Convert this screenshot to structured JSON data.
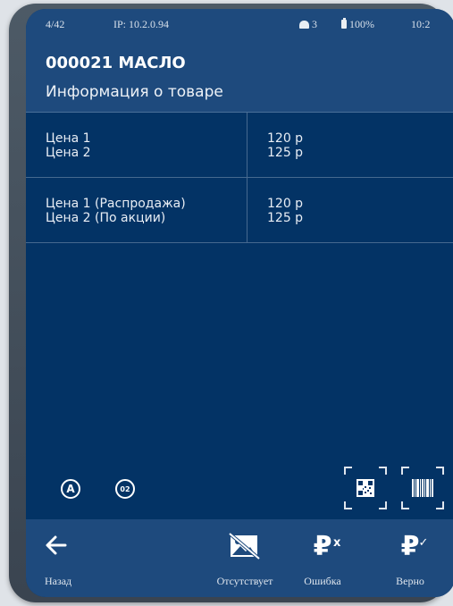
{
  "status": {
    "counter": "4/42",
    "ip": "IP: 10.2.0.94",
    "users": "3",
    "battery": "100%",
    "time": "10:2"
  },
  "header": {
    "title": "000021 МАСЛО",
    "subtitle": "Информация о товаре"
  },
  "prices": [
    {
      "label1": "Цена 1",
      "label2": "Цена 2",
      "value1": "120 р",
      "value2": "125 р"
    },
    {
      "label1": "Цена 1 (Распродажа)",
      "label2": "Цена 2 (По акции)",
      "value1": "120 р",
      "value2": "125 р"
    }
  ],
  "badges": {
    "a": "A",
    "b": "02"
  },
  "icons": {
    "users": "person-icon",
    "battery": "battery-icon",
    "back": "arrow-left-icon",
    "missing": "image-missing-icon",
    "error": "ruble-x-icon",
    "correct": "ruble-check-icon",
    "qr": "qr-code-scan-icon",
    "barcode": "barcode-scan-icon"
  },
  "actions": {
    "back": "Назад",
    "missing": "Отсутствует",
    "error": "Ошибка",
    "correct": "Верно",
    "ruble": "₽",
    "x_mark": "x",
    "check_mark": "✓"
  },
  "colors": {
    "screen_bg": "#033365",
    "bar_bg": "#1e4a7d",
    "divider": "#46698f",
    "text": "#ffffff"
  }
}
